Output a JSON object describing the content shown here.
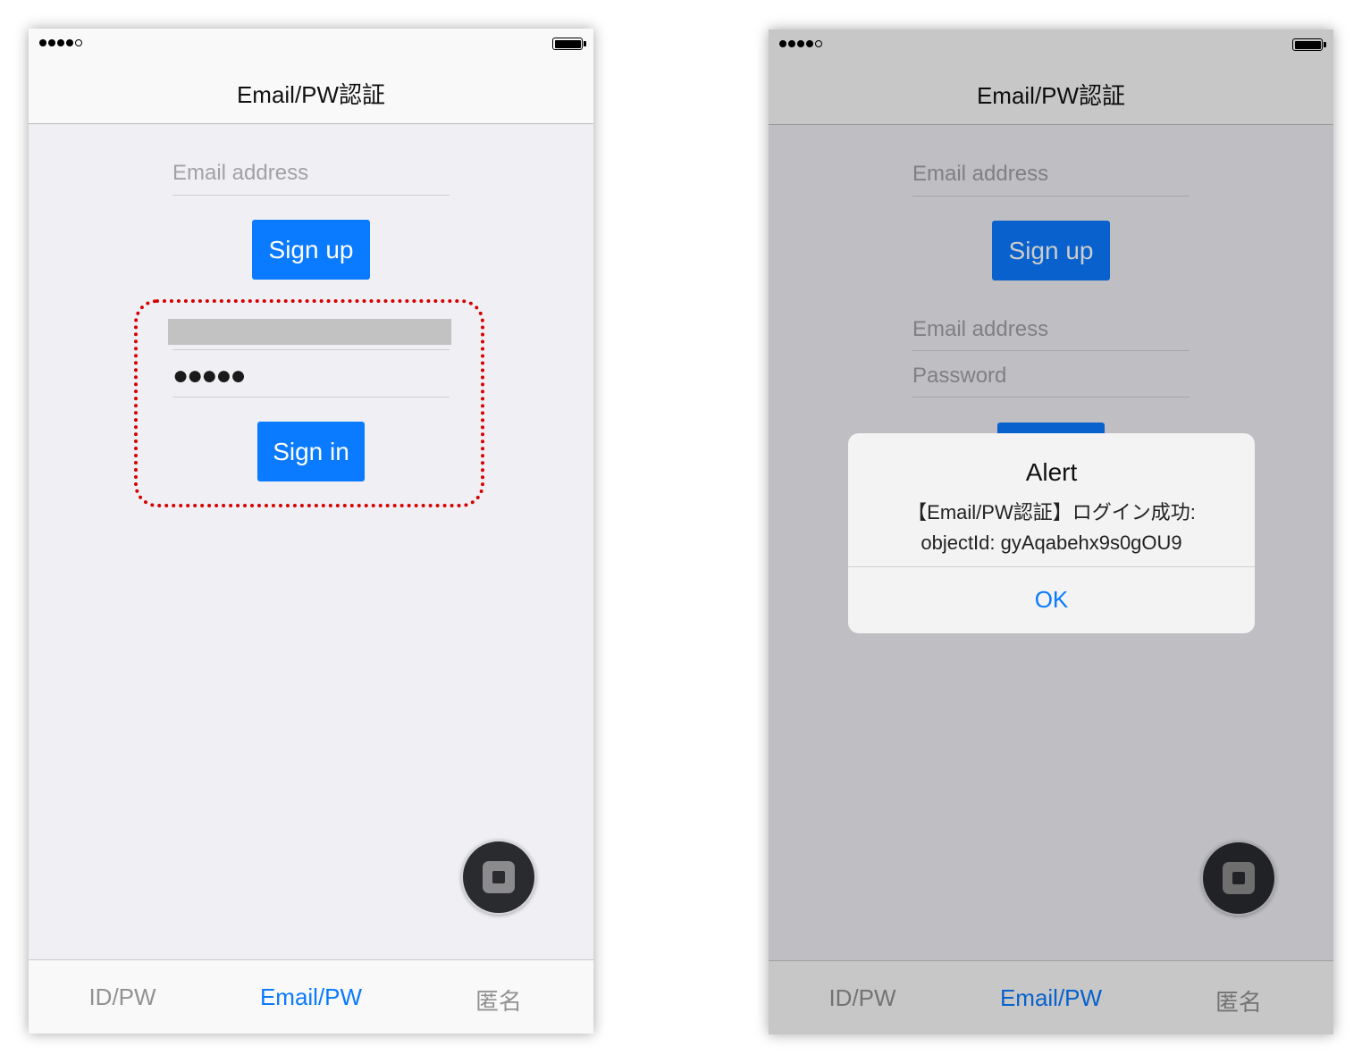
{
  "left": {
    "nav_title": "Email/PW認証",
    "signup_email_placeholder": "Email address",
    "signup_button": "Sign up",
    "signin_password_mask": "●●●●●",
    "signin_button": "Sign in",
    "tabs": [
      "ID/PW",
      "Email/PW",
      "匿名"
    ]
  },
  "right": {
    "nav_title": "Email/PW認証",
    "signup_email_placeholder": "Email address",
    "signup_button": "Sign up",
    "signin_email_placeholder": "Email address",
    "signin_password_placeholder": "Password",
    "alert": {
      "title": "Alert",
      "message_line1": "【Email/PW認証】ログイン成功:",
      "message_line2": "objectId: gyAqabehx9s0gOU9",
      "ok_label": "OK"
    },
    "tabs": [
      "ID/PW",
      "Email/PW",
      "匿名"
    ]
  },
  "active_tab_index": 1,
  "colors": {
    "accent": "#0a7aff",
    "highlight_border": "#d70000"
  },
  "icons": [
    "signal-dots-icon",
    "battery-icon",
    "stop-icon"
  ]
}
